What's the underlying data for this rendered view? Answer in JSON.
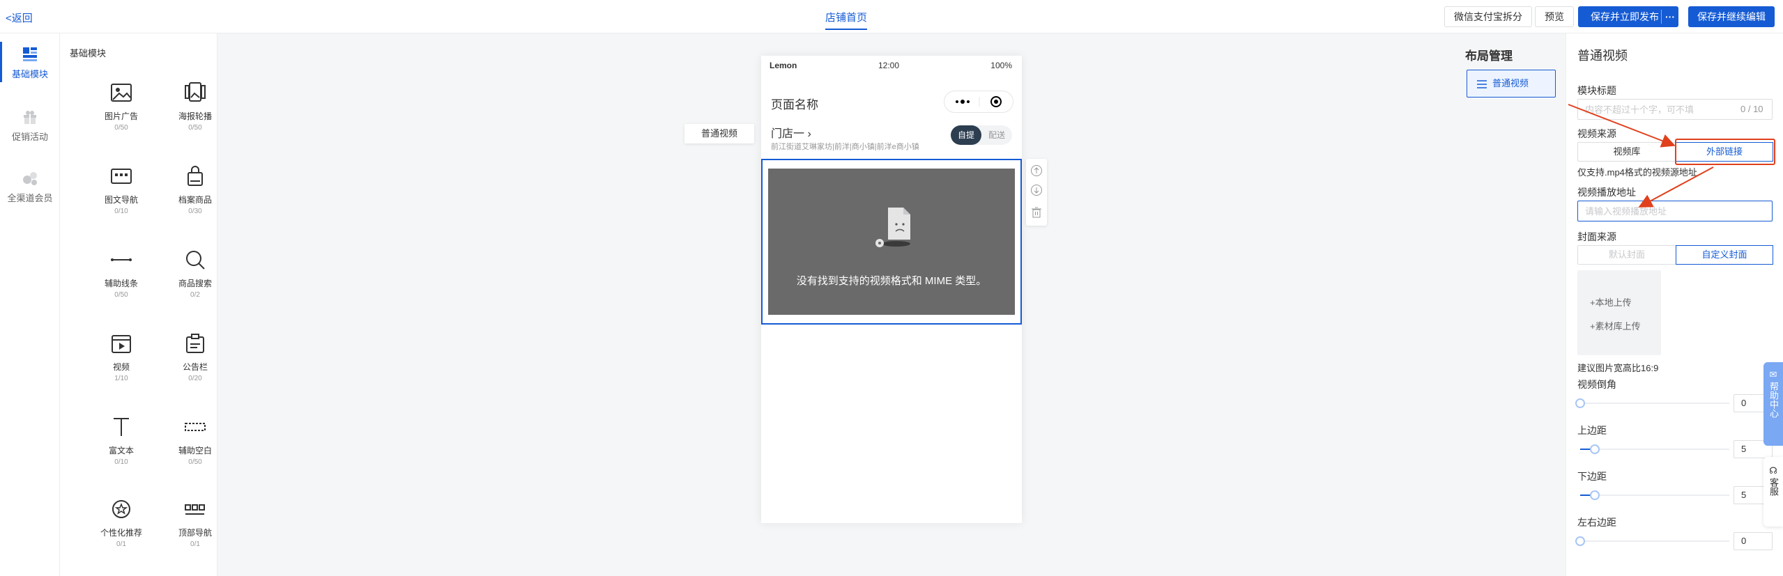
{
  "topbar": {
    "back": "<返回",
    "title": "店铺首页",
    "split_btn": "微信支付宝拆分",
    "preview_btn": "预览",
    "publish_btn": "保存并立即发布",
    "more_btn": "···",
    "save_edit_btn": "保存并继续编辑"
  },
  "rail": [
    {
      "label": "基础模块",
      "icon": "grid-blocks-icon",
      "active": true
    },
    {
      "label": "促销活动",
      "icon": "gift-icon",
      "active": false
    },
    {
      "label": "全渠道会员",
      "icon": "members-icon",
      "active": false
    }
  ],
  "modules": {
    "title": "基础模块",
    "items": [
      {
        "name": "图片广告",
        "count": "0/50",
        "icon": "image-icon"
      },
      {
        "name": "海报轮播",
        "count": "0/50",
        "icon": "poster-carousel-icon"
      },
      {
        "name": "图文导航",
        "count": "0/10",
        "icon": "image-text-nav-icon"
      },
      {
        "name": "档案商品",
        "count": "0/30",
        "icon": "bag-icon"
      },
      {
        "name": "辅助线条",
        "count": "0/50",
        "icon": "line-icon"
      },
      {
        "name": "商品搜索",
        "count": "0/2",
        "icon": "search-icon"
      },
      {
        "name": "视频",
        "count": "1/10",
        "icon": "video-icon"
      },
      {
        "name": "公告栏",
        "count": "0/20",
        "icon": "notice-icon"
      },
      {
        "name": "富文本",
        "count": "0/10",
        "icon": "rich-text-icon"
      },
      {
        "name": "辅助空白",
        "count": "0/50",
        "icon": "blank-icon"
      },
      {
        "name": "个性化推荐",
        "count": "0/1",
        "icon": "recommend-icon"
      },
      {
        "name": "顶部导航",
        "count": "0/1",
        "icon": "top-nav-icon"
      }
    ]
  },
  "canvas": {
    "float_label": "普通视频",
    "phone": {
      "carrier": "Lemon",
      "time": "12:00",
      "battery": "100%",
      "page_name": "页面名称",
      "store": "门店一 ›",
      "address": "前江街道艾琳家坊|前洋|商小镇|前洋e商小镇",
      "seg_on": "自提",
      "seg_off": "配送",
      "video_message": "没有找到支持的视频格式和 MIME 类型。"
    }
  },
  "layout": {
    "title": "布局管理",
    "item": "普通视频"
  },
  "config": {
    "title": "普通视频",
    "module_title_label": "模块标题",
    "module_title_placeholder": "内容不超过十个字，可不填",
    "module_title_count": "0 / 10",
    "source_label": "视频来源",
    "source_tabs": [
      "视频库",
      "外部链接"
    ],
    "source_hint": "仅支持.mp4格式的视频源地址",
    "url_label": "视频播放地址",
    "url_placeholder": "请输入视频播放地址",
    "cover_label": "封面来源",
    "cover_tabs": [
      "默认封面",
      "自定义封面"
    ],
    "upload_local": "+本地上传",
    "upload_library": "+素材库上传",
    "ratio_hint": "建议图片宽高比16:9",
    "sliders": [
      {
        "label": "视频倒角",
        "value": "0",
        "fraction": 0
      },
      {
        "label": "上边距",
        "value": "5",
        "fraction": 0.1
      },
      {
        "label": "下边距",
        "value": "5",
        "fraction": 0.1
      },
      {
        "label": "左右边距",
        "value": "0",
        "fraction": 0
      }
    ]
  },
  "help": {
    "label": "帮助中心",
    "kefu": "客服"
  },
  "colors": {
    "accent": "#155bd4",
    "annotation": "#e0401c"
  }
}
